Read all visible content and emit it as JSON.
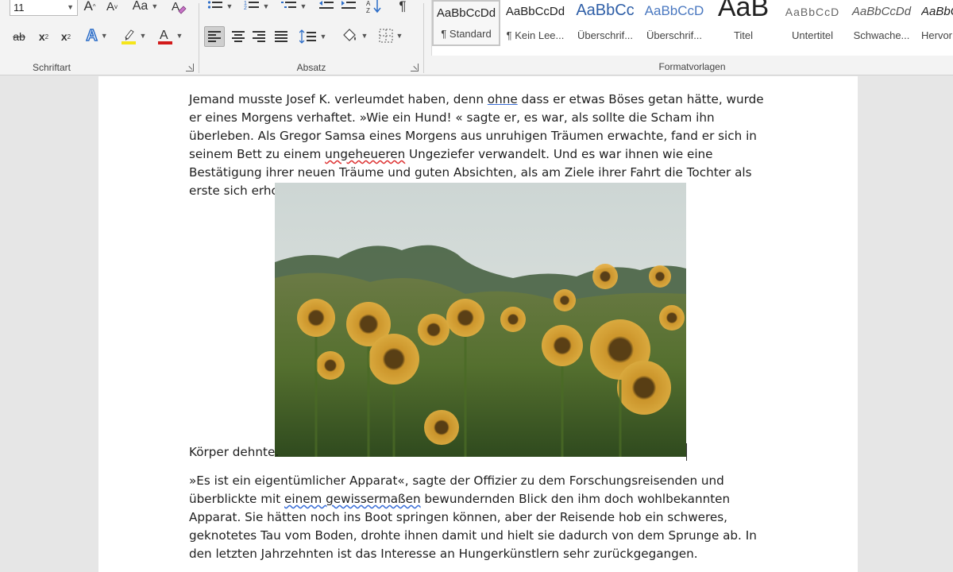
{
  "ribbon": {
    "font_group": {
      "label": "Schriftart",
      "font_size": "11",
      "grow_font": "A",
      "shrink_font": "A",
      "change_case": "Aa",
      "strikethrough": "ab",
      "subscript": "x",
      "superscript": "x",
      "text_effects": "A",
      "highlight_color": "#f5e51b",
      "font_color": "#d21a1a"
    },
    "paragraph_group": {
      "label": "Absatz"
    },
    "styles_group": {
      "label": "Formatvorlagen",
      "styles": [
        {
          "sample": "AaBbCcDd",
          "name": "¶ Standard"
        },
        {
          "sample": "AaBbCcDd",
          "name": "¶ Kein Lee..."
        },
        {
          "sample": "AaBbCc",
          "name": "Überschrif..."
        },
        {
          "sample": "AaBbCcD",
          "name": "Überschrif..."
        },
        {
          "sample": "AaB",
          "name": "Titel"
        },
        {
          "sample": "AaBbCcD",
          "name": "Untertitel"
        },
        {
          "sample": "AaBbCcDd",
          "name": "Schwache..."
        },
        {
          "sample": "AaBbCcDd",
          "name": "Hervor"
        }
      ]
    }
  },
  "document": {
    "para1": {
      "a": "Jemand musste Josef K. verleumdet haben, denn ",
      "b": "ohne",
      "c": " dass er etwas Böses getan hätte, wurde er eines Morgens verhaftet. »Wie ein Hund! « sagte er, es war, als sollte die Scham ihn überleben. Als Gregor Samsa eines Morgens aus unruhigen Träumen erwachte, fand er sich in seinem Bett zu einem ",
      "d": "ungeheueren",
      "e": " Ungeziefer verwandelt. Und es war ihnen wie eine Bestätigung ihrer neuen Träume und guten Absichten, als am Ziele ihrer Fahrt die Tochter als erste sich erhob und ihren jungen"
    },
    "after_image": "Körper dehnte.",
    "para2": {
      "a": "»Es ist ein eigentümlicher Apparat«, sagte der Offizier zu dem Forschungsreisenden und überblickte mit ",
      "b": "einem gewissermaßen",
      "c": " bewundernden Blick den ihm doch wohlbekannten Apparat. Sie hätten noch ins Boot springen können, aber der Reisende hob ein schweres, geknotetes Tau vom Boden, drohte ihnen damit und hielt sie dadurch von dem Sprunge ab. In den letzten Jahrzehnten ist das Interesse an Hungerkünstlern sehr zurückgegangen."
    }
  }
}
